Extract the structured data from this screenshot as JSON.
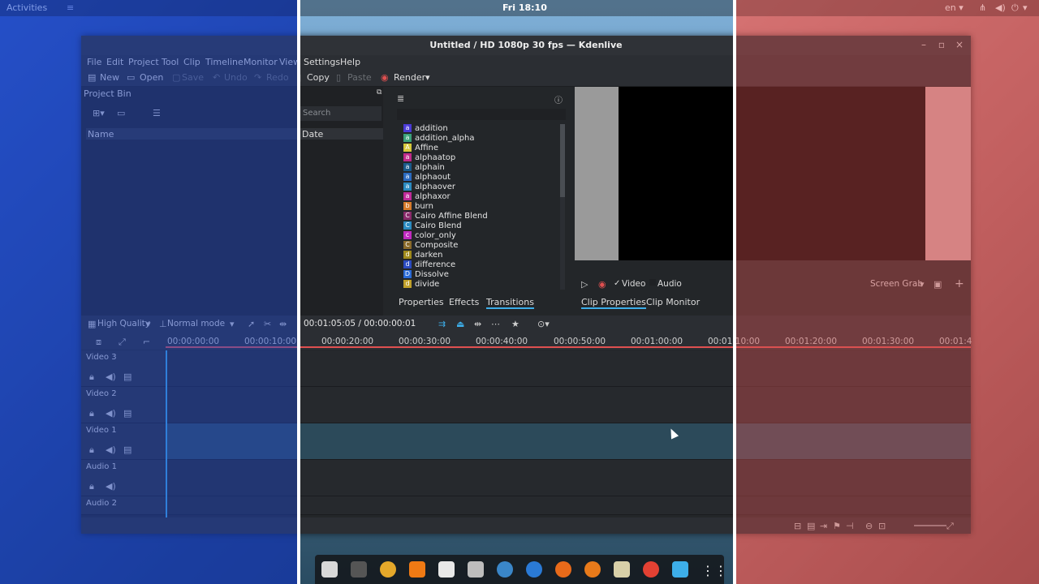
{
  "topbar": {
    "activities": "Activities",
    "clock": "Fri 18:10",
    "lang": "en ▾"
  },
  "window": {
    "title": "Untitled / HD 1080p 30 fps — Kdenlive"
  },
  "menu": [
    "File",
    "Edit",
    "Project",
    "Tool",
    "Clip",
    "Timeline",
    "Monitor",
    "View",
    "Settings",
    "Help"
  ],
  "toolbar": {
    "new": "New",
    "open": "Open",
    "save": "Save",
    "undo": "Undo",
    "redo": "Redo",
    "copy": "Copy",
    "paste": "Paste",
    "render": "Render"
  },
  "project_bin": {
    "title": "Project Bin",
    "search_placeholder": "Search",
    "col_name": "Name",
    "col_date": "Date"
  },
  "transitions": {
    "items": [
      {
        "letter": "a",
        "name": "addition",
        "color": "#4a3ad6"
      },
      {
        "letter": "a",
        "name": "addition_alpha",
        "color": "#3aa07a"
      },
      {
        "letter": "A",
        "name": "Affine",
        "color": "#d6c83a"
      },
      {
        "letter": "a",
        "name": "alphaatop",
        "color": "#c02a8a"
      },
      {
        "letter": "a",
        "name": "alphain",
        "color": "#1a5a8a"
      },
      {
        "letter": "a",
        "name": "alphaout",
        "color": "#2a6ac0"
      },
      {
        "letter": "a",
        "name": "alphaover",
        "color": "#2a8ac0"
      },
      {
        "letter": "a",
        "name": "alphaxor",
        "color": "#c02a9a"
      },
      {
        "letter": "b",
        "name": "burn",
        "color": "#d67a2a"
      },
      {
        "letter": "C",
        "name": "Cairo Affine Blend",
        "color": "#8a2a6a"
      },
      {
        "letter": "C",
        "name": "Cairo Blend",
        "color": "#2a8ac0"
      },
      {
        "letter": "c",
        "name": "color_only",
        "color": "#c02ac0"
      },
      {
        "letter": "C",
        "name": "Composite",
        "color": "#8a6a2a"
      },
      {
        "letter": "d",
        "name": "darken",
        "color": "#a08a1a"
      },
      {
        "letter": "d",
        "name": "difference",
        "color": "#2a4ac0"
      },
      {
        "letter": "D",
        "name": "Dissolve",
        "color": "#2a6ad6"
      },
      {
        "letter": "d",
        "name": "divide",
        "color": "#c0a02a"
      }
    ],
    "tabs": [
      "Properties",
      "Effects",
      "Transitions"
    ],
    "active_tab": "Transitions"
  },
  "monitor": {
    "video_label": "Video",
    "audio_label": "Audio",
    "screen_grab": "Screen Grab",
    "tabs": [
      "Clip Properties",
      "Clip Monitor"
    ]
  },
  "timeline": {
    "quality": "High Quality",
    "mode": "Normal mode",
    "timecode": "00:01:05:05 / 00:00:00:01",
    "ruler": [
      "00:00:00:00",
      "00:00:10:00",
      "00:00:20:00",
      "00:00:30:00",
      "00:00:40:00",
      "00:00:50:00",
      "00:01:00:00",
      "00:01:10:00",
      "00:01:20:00",
      "00:01:30:00",
      "00:01:4"
    ],
    "tracks": [
      "Video 3",
      "Video 2",
      "Video 1",
      "Audio 1",
      "Audio 2"
    ]
  }
}
